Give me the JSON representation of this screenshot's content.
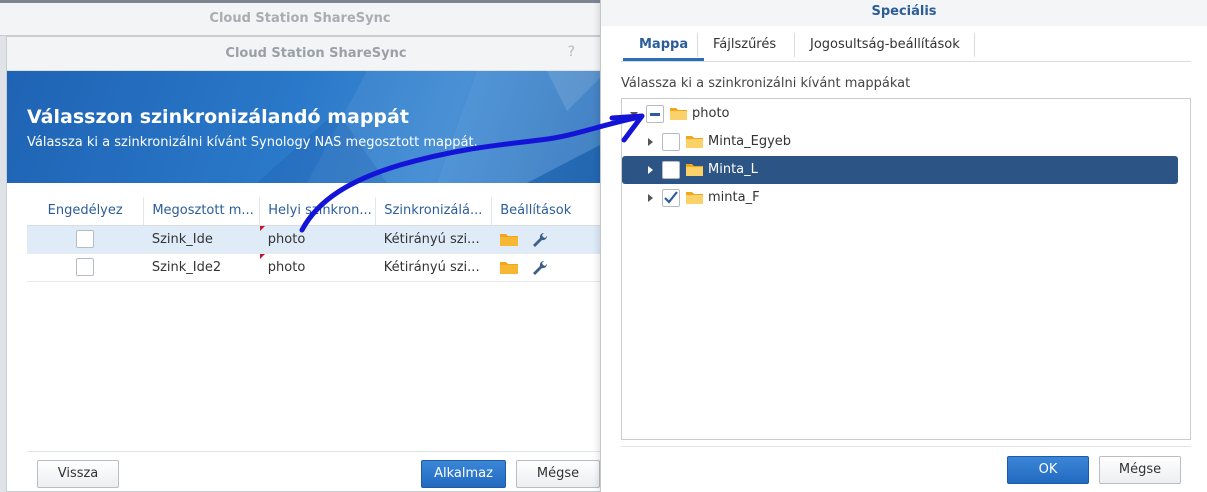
{
  "background_window": {
    "title": "Cloud Station ShareSync"
  },
  "main_dialog": {
    "title": "Cloud Station ShareSync",
    "help_glyph": "?",
    "heading": "Válasszon szinkronizálandó mappát",
    "subheading": "Válassza ki a szinkronizálni kívánt Synology NAS megosztott mappát.",
    "columns": [
      "Engedélyez",
      "Megosztott m...",
      "Helyi szinkron...",
      "Szinkronizálá...",
      "Beállítások"
    ],
    "rows": [
      {
        "enabled": false,
        "share": "Szink_Ide",
        "local": "photo",
        "sync": "Kétirányú szi...",
        "selected": true
      },
      {
        "enabled": false,
        "share": "Szink_Ide2",
        "local": "photo",
        "sync": "Kétirányú szi...",
        "selected": false
      }
    ],
    "buttons": {
      "back": "Vissza",
      "apply": "Alkalmaz",
      "cancel": "Mégse"
    }
  },
  "special_dialog": {
    "title": "Speciális",
    "tabs": [
      "Mappa",
      "Fájlszűrés",
      "Jogosultság-beállítások"
    ],
    "active_tab": "Mappa",
    "instruction": "Válassza ki a szinkronizálni kívánt mappákat",
    "tree": {
      "root": {
        "label": "photo",
        "expanded": true,
        "state": "partial"
      },
      "children": [
        {
          "label": "Minta_Egyeb",
          "state": "unchecked",
          "selected": false
        },
        {
          "label": "Minta_L",
          "state": "unchecked",
          "selected": true
        },
        {
          "label": "minta_F",
          "state": "checked",
          "selected": false
        }
      ]
    },
    "buttons": {
      "ok": "OK",
      "cancel": "Mégse"
    }
  },
  "icons": {
    "folder": "folder-icon",
    "wrench": "wrench-icon",
    "expand": "chevron-right-icon",
    "collapse": "chevron-down-icon"
  },
  "colors": {
    "accent": "#2b6fb8",
    "banner": "#2a78c9",
    "selected_row": "#dfecf8",
    "selected_node": "#2c5585",
    "annotation": "#1414d8",
    "folder": "#f2a71b"
  }
}
